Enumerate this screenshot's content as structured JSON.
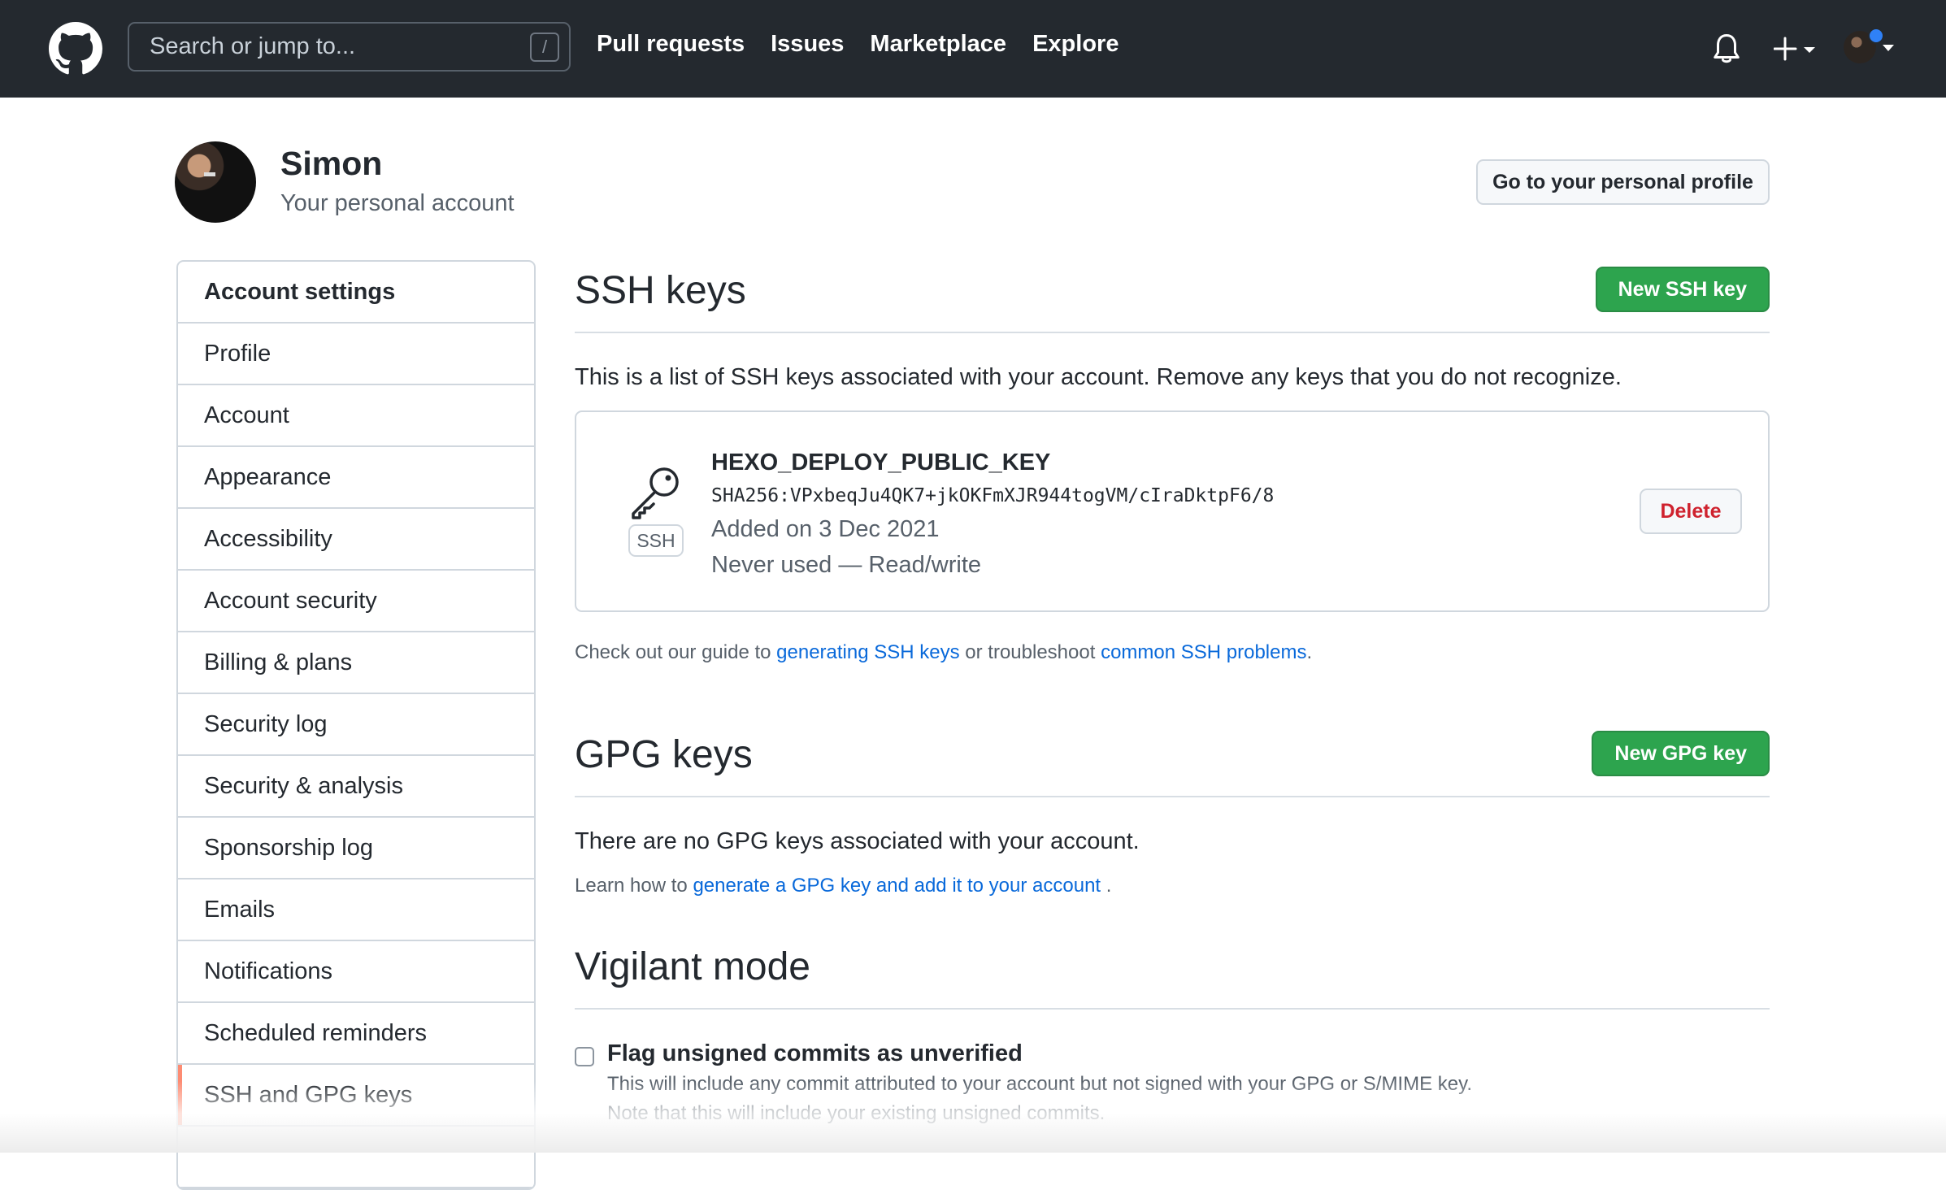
{
  "header": {
    "search_placeholder": "Search or jump to...",
    "search_shortcut": "/",
    "nav": [
      {
        "label": "Pull requests"
      },
      {
        "label": "Issues"
      },
      {
        "label": "Marketplace"
      },
      {
        "label": "Explore"
      }
    ],
    "icons": {
      "logo": "github-mark-icon",
      "notifications": "bell-icon",
      "create": "plus-icon",
      "avatar": "user-avatar"
    }
  },
  "user": {
    "name": "Simon",
    "subtitle": "Your personal account",
    "profile_button": "Go to your personal profile"
  },
  "sidebar": {
    "heading": "Account settings",
    "items": [
      {
        "label": "Profile"
      },
      {
        "label": "Account"
      },
      {
        "label": "Appearance"
      },
      {
        "label": "Accessibility"
      },
      {
        "label": "Account security"
      },
      {
        "label": "Billing & plans"
      },
      {
        "label": "Security log"
      },
      {
        "label": "Security & analysis"
      },
      {
        "label": "Sponsorship log"
      },
      {
        "label": "Emails"
      },
      {
        "label": "Notifications"
      },
      {
        "label": "Scheduled reminders"
      },
      {
        "label": "SSH and GPG keys",
        "active": true
      }
    ]
  },
  "ssh": {
    "title": "SSH keys",
    "new_button": "New SSH key",
    "intro": "This is a list of SSH keys associated with your account. Remove any keys that you do not recognize.",
    "key": {
      "badge": "SSH",
      "title": "HEXO_DEPLOY_PUBLIC_KEY",
      "fingerprint": "SHA256:VPxbeqJu4QK7+jkOKFmXJR944togVM/cIraDktpF6/8",
      "added": "Added on 3 Dec 2021",
      "usage": "Never used — Read/write",
      "delete_button": "Delete"
    },
    "guide_prefix": "Check out our guide to ",
    "guide_link1": "generating SSH keys",
    "guide_middle": " or troubleshoot ",
    "guide_link2": "common SSH problems",
    "guide_suffix": "."
  },
  "gpg": {
    "title": "GPG keys",
    "new_button": "New GPG key",
    "none_text": "There are no GPG keys associated with your account.",
    "learn_prefix": "Learn how to ",
    "learn_link": "generate a GPG key and add it to your account",
    "learn_suffix": " ."
  },
  "vigilant": {
    "title": "Vigilant mode",
    "flag_label": "Flag unsigned commits as unverified",
    "flag_desc": "This will include any commit attributed to your account but not signed with your GPG or S/MIME key.",
    "flag_desc2": "Note that this will include your existing unsigned commits."
  },
  "colors": {
    "header_bg": "#24292f",
    "primary_green": "#2da44e",
    "link_blue": "#0969da",
    "danger_red": "#cf222e",
    "active_marker": "#fd8c73"
  }
}
